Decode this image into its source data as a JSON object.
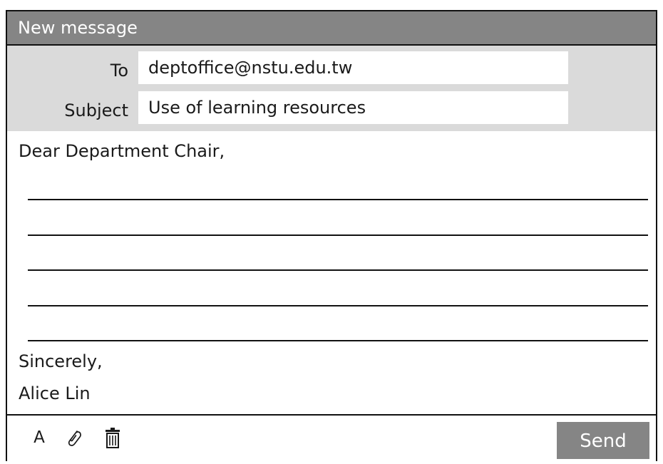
{
  "window": {
    "title": "New message"
  },
  "fields": {
    "to_label": "To",
    "to_value": "deptoffice@nstu.edu.tw",
    "subject_label": "Subject",
    "subject_value": "Use of learning resources"
  },
  "body": {
    "greeting": "Dear Department Chair,",
    "closing": "Sincerely,",
    "signature": "Alice Lin"
  },
  "toolbar": {
    "font_label": "A",
    "attach_icon": "paperclip-icon",
    "delete_icon": "trash-icon",
    "send_label": "Send"
  },
  "colors": {
    "title_bar": "#858585",
    "header_background": "#dadada",
    "send_button": "#858585",
    "border": "#111111"
  }
}
